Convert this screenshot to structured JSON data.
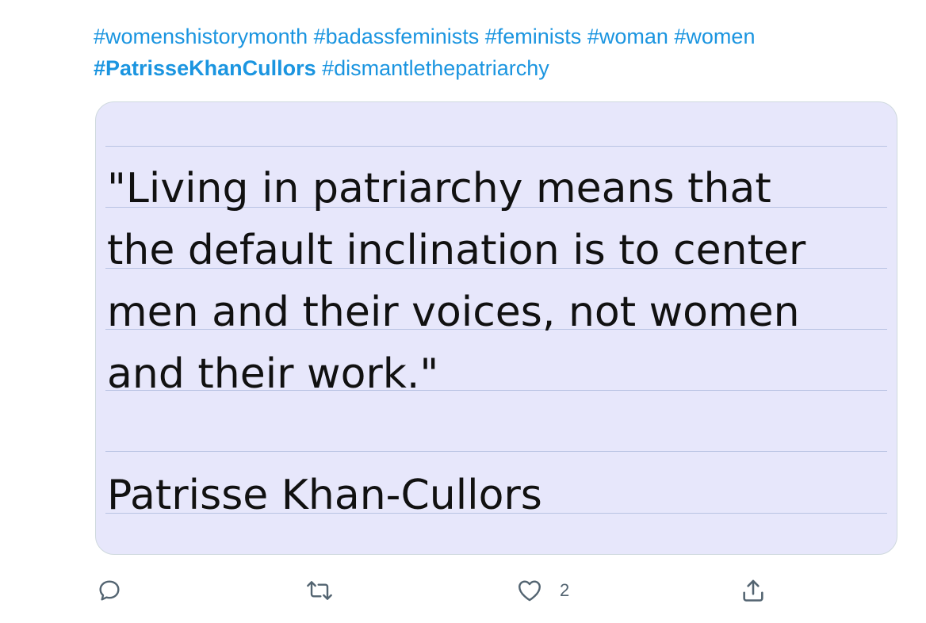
{
  "tweet": {
    "line1_tags": [
      "#womenshistorymonth",
      "#badassfeminists",
      "#feminists",
      "#woman",
      "#women"
    ],
    "line2_tag_bold": "#PatrisseKhanCullors",
    "line2_tag": "#dismantlethepatriarchy"
  },
  "image": {
    "quote_lines": [
      "\"Living in patriarchy means that",
      "the default inclination is to center",
      "men and their voices, not women",
      "and their work.\""
    ],
    "author": "Patrisse Khan-Cullors"
  },
  "actions": {
    "reply_icon": "reply-icon",
    "retweet_icon": "retweet-icon",
    "like_icon": "heart-icon",
    "like_count": "2",
    "share_icon": "share-icon"
  },
  "colors": {
    "link": "#1b95e0",
    "card_background": "#e7e7fb",
    "icon": "#536471"
  }
}
